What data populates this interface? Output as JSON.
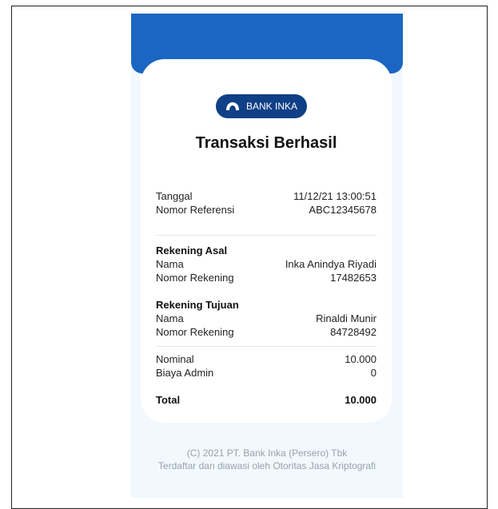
{
  "brand": {
    "logo_text": "BANK INKA",
    "icon": "bank-logo-icon",
    "accent": "#1a66c2",
    "pill_color": "#0f3f86"
  },
  "title": "Transaksi Berhasil",
  "meta": {
    "date_label": "Tanggal",
    "date_value": "11/12/21 13:00:51",
    "ref_label": "Nomor Referensi",
    "ref_value": "ABC12345678"
  },
  "source": {
    "heading": "Rekening Asal",
    "name_label": "Nama",
    "name_value": "Inka Anindya Riyadi",
    "account_label": "Nomor Rekening",
    "account_value": "17482653"
  },
  "destination": {
    "heading": "Rekening Tujuan",
    "name_label": "Nama",
    "name_value": "Rinaldi Munir",
    "account_label": "Nomor Rekening",
    "account_value": "84728492"
  },
  "amounts": {
    "nominal_label": "Nominal",
    "nominal_value": "10.000",
    "fee_label": "Biaya Admin",
    "fee_value": "0",
    "total_label": "Total",
    "total_value": "10.000"
  },
  "footer": {
    "copyright": "(C) 2021 PT. Bank Inka (Persero) Tbk",
    "regulator": "Terdaftar dan diawasi oleh Otoritas Jasa Kriptografi"
  }
}
